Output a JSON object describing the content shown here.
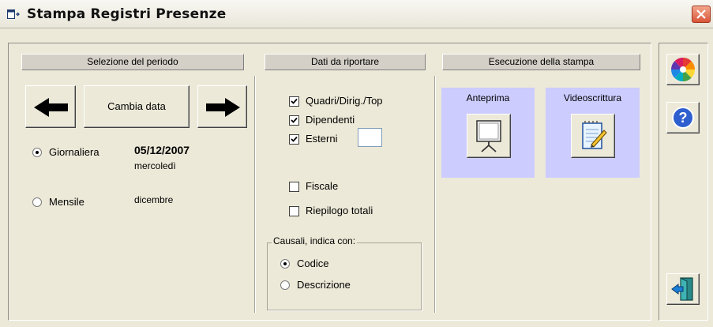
{
  "window": {
    "title": "Stampa Registri Presenze"
  },
  "periodo": {
    "header": "Selezione del periodo",
    "cambia_data_label": "Cambia data",
    "giornaliera_label": "Giornaliera",
    "giornaliera_date": "05/12/2007",
    "giornaliera_day": "mercoledì",
    "mensile_label": "Mensile",
    "mensile_month": "dicembre",
    "selected": "Giornaliera"
  },
  "dati": {
    "header": "Dati da riportare",
    "quadri_label": "Quadri/Dirig./Top",
    "quadri_checked": true,
    "dipendenti_label": "Dipendenti",
    "dipendenti_checked": true,
    "esterni_label": "Esterni",
    "esterni_checked": true,
    "esterni_value": "",
    "fiscale_label": "Fiscale",
    "fiscale_checked": false,
    "riepilogo_label": "Riepilogo totali",
    "riepilogo_checked": false,
    "causali_legend": "Causali, indica con:",
    "codice_label": "Codice",
    "descrizione_label": "Descrizione",
    "causali_selected": "Codice"
  },
  "stampa": {
    "header": "Esecuzione della stampa",
    "anteprima_label": "Anteprima",
    "videoscrittura_label": "Videoscrittura"
  },
  "colors": {
    "preview_bg": "#ccccff",
    "close_button": "#d9553a"
  },
  "icons": {
    "app": "app-window-icon",
    "close": "close-x-icon",
    "left": "arrow-left-icon",
    "right": "arrow-right-icon",
    "anteprima": "projector-screen-icon",
    "videoscrittura": "notepad-pencil-icon",
    "colors": "color-wheel-icon",
    "help": "question-mark-icon",
    "exit": "exit-door-icon"
  }
}
